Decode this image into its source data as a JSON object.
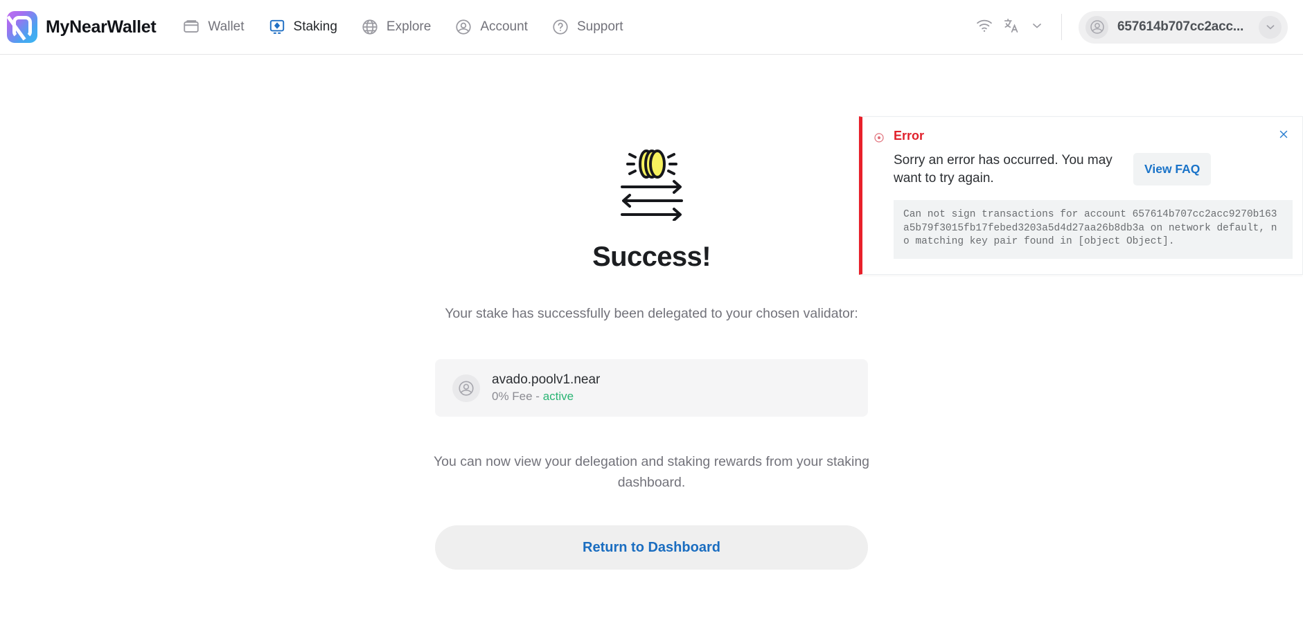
{
  "header": {
    "brand": "MyNearWallet",
    "logo_icon": "near-logo-icon",
    "nav": [
      {
        "label": "Wallet",
        "icon": "wallet-icon",
        "active": false
      },
      {
        "label": "Staking",
        "icon": "staking-icon",
        "active": true
      },
      {
        "label": "Explore",
        "icon": "globe-icon",
        "active": false
      },
      {
        "label": "Account",
        "icon": "account-icon",
        "active": false
      },
      {
        "label": "Support",
        "icon": "help-circle-icon",
        "active": false
      }
    ],
    "network_icon": "wifi-icon",
    "language_icon": "translate-icon",
    "language_chevron_icon": "chevron-down-icon",
    "account_pill": {
      "avatar_icon": "account-avatar-icon",
      "name": "657614b707cc2acc...",
      "chevron_icon": "chevron-down-icon"
    }
  },
  "main": {
    "hero_icon": "staking-coins-transfer-icon",
    "title": "Success!",
    "lead_text": "Your stake has successfully been delegated to your chosen validator:",
    "validator": {
      "avatar_icon": "validator-avatar-icon",
      "name": "avado.poolv1.near",
      "fee": "0% Fee - ",
      "status": "active",
      "status_color": "#29b473"
    },
    "sub_text": "You can now view your delegation and staking rewards from your staking dashboard.",
    "return_button": "Return to Dashboard",
    "return_button_color": "#1a6dc0"
  },
  "toast": {
    "alert_icon": "error-circle-icon",
    "title": "Error",
    "title_color": "#e0202b",
    "accent_color": "#e8202a",
    "message": "Sorry an error has occurred. You may want to try again.",
    "faq_button": "View FAQ",
    "code": "Can not sign transactions for account 657614b707cc2acc9270b163a5b79f3015fb17febed3203a5d4d27aa26b8db3a on network default, no matching key pair found in [object Object].",
    "close_icon": "close-icon"
  }
}
